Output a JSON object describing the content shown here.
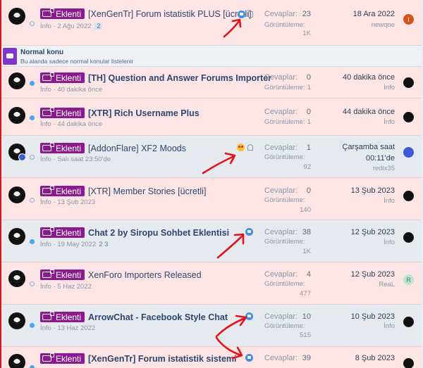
{
  "section": {
    "title": "Normal konu",
    "description": "Bu alanda sadece normal konular listelenir"
  },
  "labels": {
    "replies": "Cevaplar:",
    "views": "Görüntüleme:"
  },
  "threads": [
    {
      "prefix": "Eklenti",
      "title": "[XenGenTr] Forum istatistik PLUS [ücretli]",
      "meta_author": "İnfo",
      "meta_date": "2 Ağu 2022",
      "page": "2",
      "replies": "23",
      "views": "1K",
      "last_date": "18 Ara 2022",
      "last_user": "newqne",
      "last_avatar_letter": "I"
    },
    {
      "prefix": "Eklenti",
      "title": "[TH] Question and Answer Forums Importer",
      "meta_author": "İnfo",
      "meta_date": "40 dakika önce",
      "replies": "0",
      "views": "1",
      "last_date": "40 dakika önce",
      "last_user": "İnfo"
    },
    {
      "prefix": "Eklenti",
      "title": "[XTR] Rich Username Plus",
      "meta_author": "İnfo",
      "meta_date": "44 dakika önce",
      "replies": "0",
      "views": "1",
      "last_date": "44 dakika önce",
      "last_user": "İnfo"
    },
    {
      "prefix": "Eklenti",
      "title": "[AddonFlare] XF2 Moods",
      "meta_author": "İnfo",
      "meta_date": "Salı saat 23:50'de",
      "replies": "1",
      "views": "92",
      "last_date": "Çarşamba saat",
      "last_date2": "00:11'de",
      "last_user": "redix35"
    },
    {
      "prefix": "Eklenti",
      "title": "[XTR] Member Stories [ücretli]",
      "meta_author": "İnfo",
      "meta_date": "13 Şub 2023",
      "replies": "0",
      "views": "140",
      "last_date": "13 Şub 2023",
      "last_user": "İnfo"
    },
    {
      "prefix": "Eklenti",
      "title": "Chat 2 by Siropu Sohbet Eklentisi",
      "meta_author": "İnfo",
      "meta_date": "19 May 2022",
      "pages": "2 3",
      "replies": "38",
      "views": "1K",
      "last_date": "12 Şub 2023",
      "last_user": "İnfo"
    },
    {
      "prefix": "Eklenti",
      "title": "XenForo Importers Released",
      "meta_author": "İnfo",
      "meta_date": "5 Haz 2022",
      "replies": "4",
      "views": "477",
      "last_date": "12 Şub 2023",
      "last_user": "ReaL",
      "last_avatar_letter": "R"
    },
    {
      "prefix": "Eklenti",
      "title": "ArrowChat - Facebook Style Chat",
      "meta_author": "İnfo",
      "meta_date": "13 Haz 2022",
      "replies": "10",
      "views": "515",
      "last_date": "10 Şub 2023",
      "last_user": "İnfo"
    },
    {
      "prefix": "Eklenti",
      "title": "[XenGenTr] Forum istatistik sistemi",
      "replies": "39",
      "last_date": "8 Şub 2023"
    }
  ],
  "colors": {
    "prefix_bg": "#8b1a8e",
    "row_pink": "#fde5e5",
    "row_gray": "#e6e9ee",
    "annotation_red": "#e0141c",
    "left_border": "#d2171d"
  }
}
